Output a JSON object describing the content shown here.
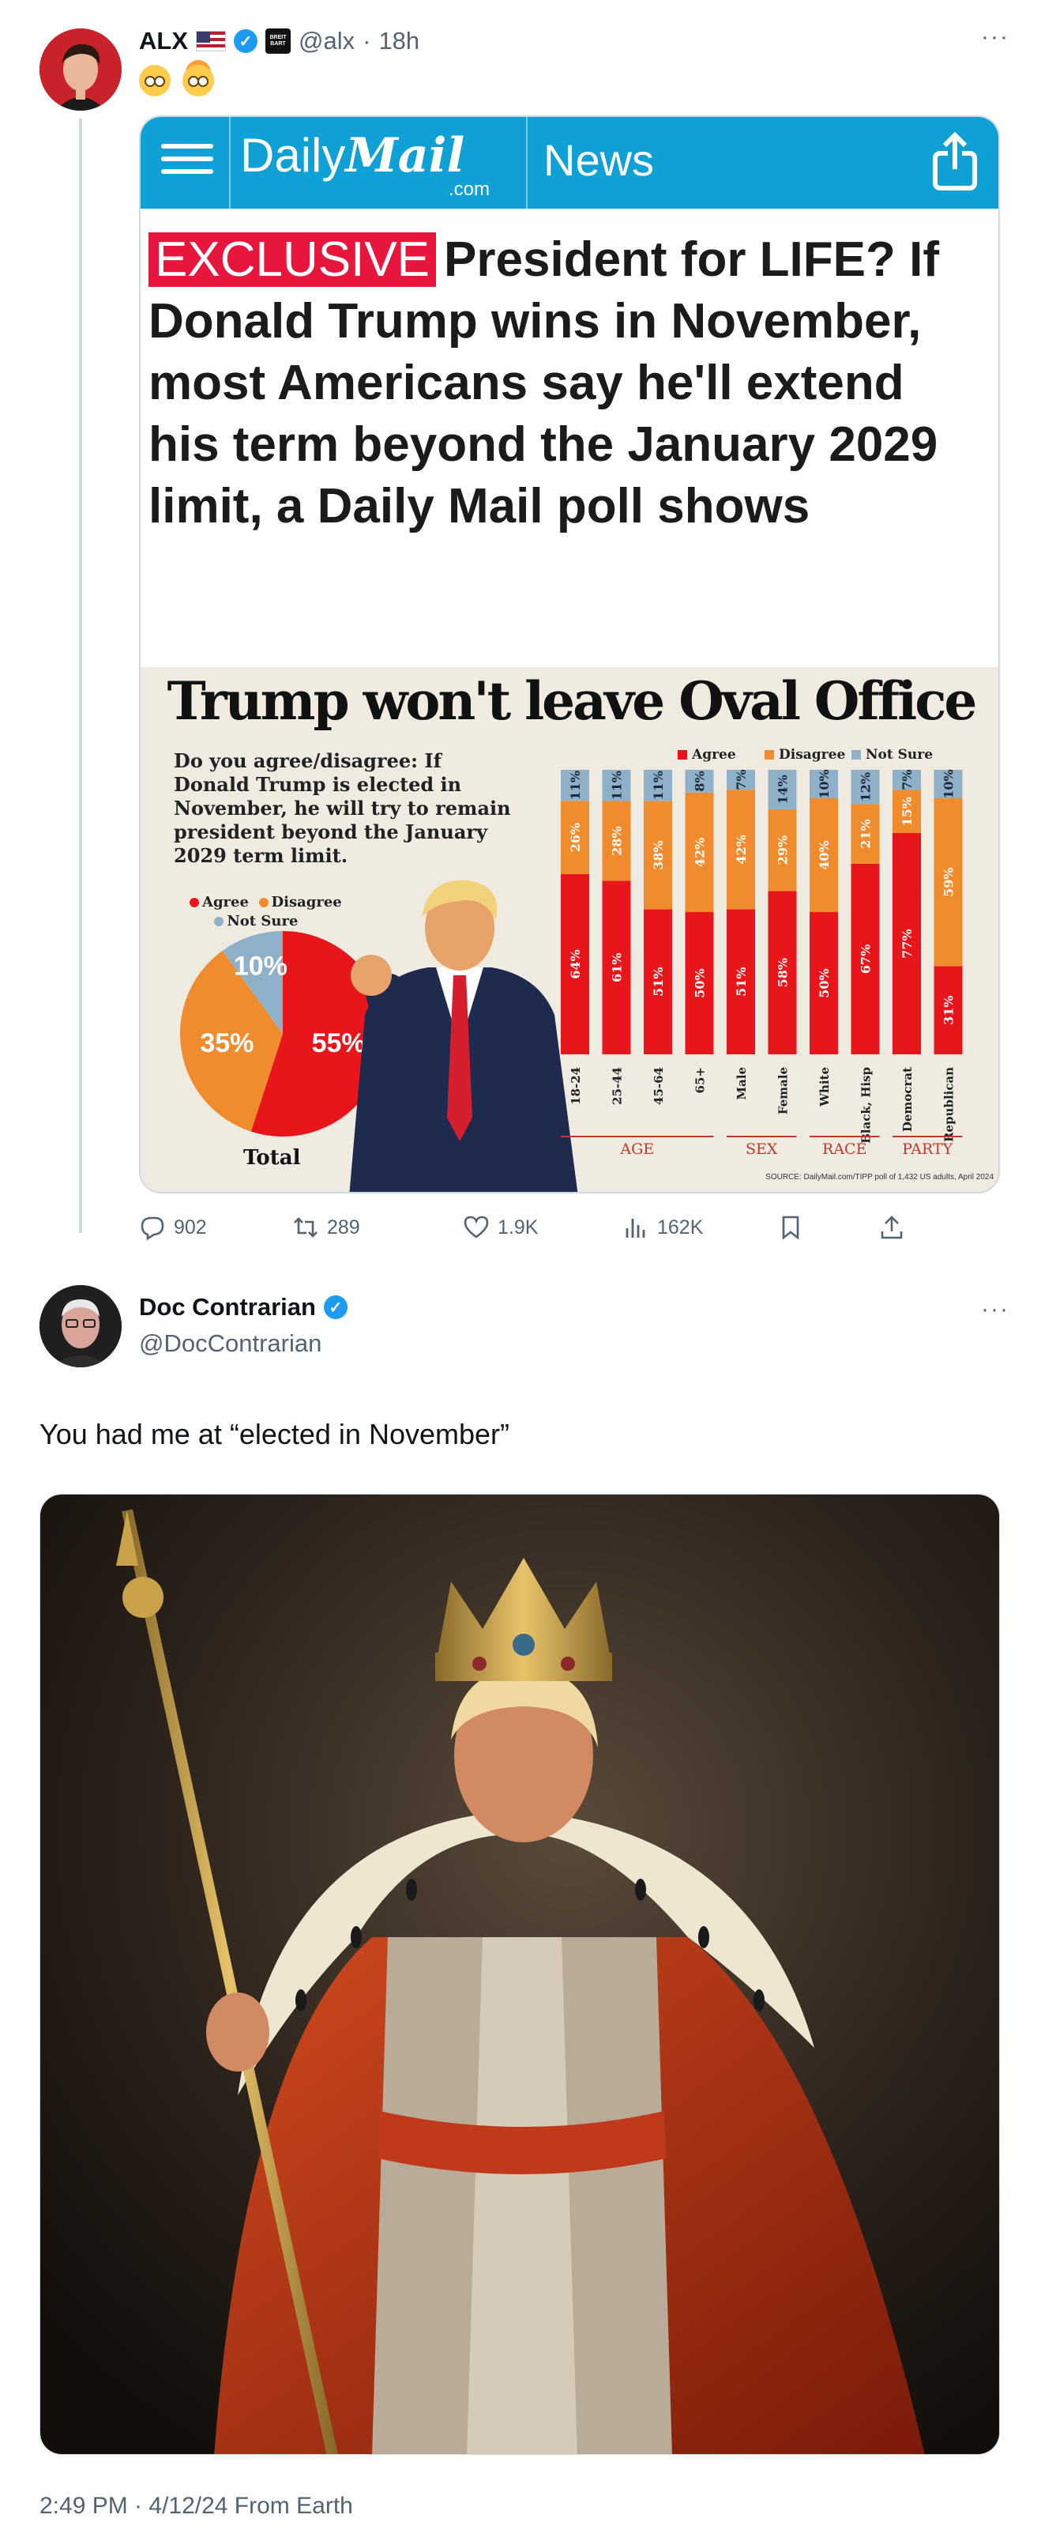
{
  "tweet1": {
    "author": {
      "name": "ALX",
      "handle": "@alx",
      "time": "18h",
      "flag": "us-flag-icon",
      "affiliation": "Breitbart"
    },
    "text_emojis": [
      "flushed-face-emoji",
      "exploding-head-emoji"
    ],
    "article": {
      "site": {
        "daily": "Daily",
        "mail": "Mail",
        "com": ".com",
        "section": "News"
      },
      "tag": "EXCLUSIVE",
      "headline": "President for LIFE? If Donald Trump wins in November, most Americans say he'll extend his term beyond the January 2029 limit, a Daily Mail poll shows",
      "graphic": {
        "title": "Trump won't leave Oval Office",
        "question": "Do you agree/disagree: If Donald Trump is elected in November, he will try to remain president beyond the January 2029 term limit.",
        "legend": {
          "agree": "Agree",
          "disagree": "Disagree",
          "not_sure": "Not Sure"
        },
        "total_label": "Total",
        "groups": [
          "AGE",
          "SEX",
          "RACE",
          "PARTY"
        ],
        "source": "SOURCE: DailyMail.com/TIPP poll of 1,432 US adults, April 2024"
      }
    },
    "stats": {
      "replies": "902",
      "reposts": "289",
      "likes": "1.9K",
      "views": "162K"
    }
  },
  "tweet2": {
    "author": {
      "name": "Doc Contrarian",
      "handle": "@DocContrarian"
    },
    "text": "You had me at “elected in November”",
    "footer": "2:49 PM · 4/12/24 From Earth"
  },
  "colors": {
    "agree": "#e8161b",
    "disagree": "#f08c2e",
    "not_sure": "#8fb0c9",
    "dm_blue": "#0fa1d6",
    "verified": "#1d9bf0"
  },
  "chart_data": [
    {
      "type": "pie",
      "title": "Total",
      "categories": [
        "Agree",
        "Disagree",
        "Not Sure"
      ],
      "values": [
        55,
        35,
        10
      ],
      "labels": [
        "55%",
        "35%",
        "10%"
      ]
    },
    {
      "type": "bar",
      "stacked": true,
      "categories": [
        "18-24",
        "25-44",
        "45-64",
        "65+",
        "Male",
        "Female",
        "White",
        "Black, Hisp",
        "Democrat",
        "Republican"
      ],
      "series": [
        {
          "name": "Agree",
          "values": [
            64,
            61,
            51,
            50,
            51,
            58,
            50,
            67,
            77,
            31
          ]
        },
        {
          "name": "Disagree",
          "values": [
            26,
            28,
            38,
            42,
            42,
            29,
            40,
            21,
            15,
            59
          ]
        },
        {
          "name": "Not Sure",
          "values": [
            11,
            11,
            11,
            8,
            7,
            14,
            10,
            12,
            7,
            10
          ]
        }
      ],
      "labels": {
        "Agree": [
          "64%",
          "61%",
          "51%",
          "50%",
          "51%",
          "58%",
          "50%",
          "67%",
          "77%",
          "31%"
        ],
        "Disagree": [
          "26%",
          "28%",
          "38%",
          "42%",
          "42%",
          "29%",
          "40%",
          "21%",
          "15%",
          "59%"
        ],
        "Not Sure": [
          "11%",
          "11%",
          "11%",
          "8%",
          "7%",
          "14%",
          "10%",
          "12%",
          "7%",
          "10%"
        ]
      },
      "groups": [
        {
          "name": "AGE",
          "span": [
            0,
            3
          ]
        },
        {
          "name": "SEX",
          "span": [
            4,
            5
          ]
        },
        {
          "name": "RACE",
          "span": [
            6,
            7
          ]
        },
        {
          "name": "PARTY",
          "span": [
            8,
            9
          ]
        }
      ]
    }
  ]
}
